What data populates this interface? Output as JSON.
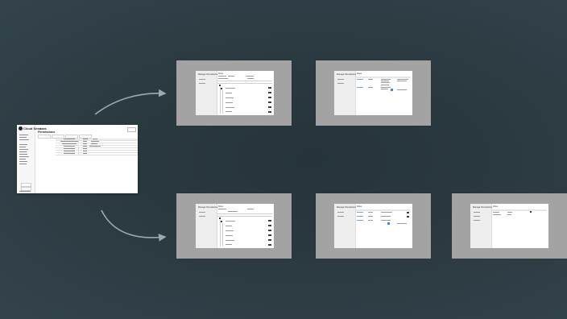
{
  "colors": {
    "background": "#2b3940",
    "frame": "#a3a3a3",
    "arrow": "#9aaab2",
    "accent": "#3d8ad1"
  },
  "app": {
    "brand": "Cloud Services",
    "header_text": "Admin",
    "page_title": "Permissions"
  },
  "flow": {
    "top_row": {
      "frame1": {
        "sidebar_title": "Manage Permissions",
        "main_title": "Roles"
      },
      "frame2": {
        "sidebar_title": "Manage Permissions",
        "main_title": "Roles"
      }
    },
    "bottom_row": {
      "frame1": {
        "sidebar_title": "Manage Permissions",
        "main_title": "Roles"
      },
      "frame2": {
        "sidebar_title": "Manage Permissions",
        "main_title": "Roles"
      },
      "frame3": {
        "sidebar_title": "Manage Permissions",
        "main_title": "Roles"
      }
    }
  }
}
